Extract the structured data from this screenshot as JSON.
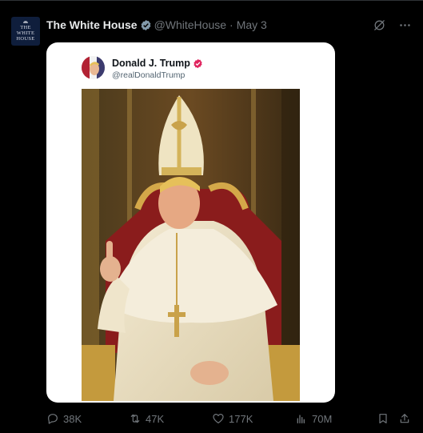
{
  "author": {
    "name": "The White House",
    "handle": "@WhiteHouse",
    "date": "May 3",
    "avatar_text": [
      "THE",
      "WHITE",
      "HOUSE"
    ]
  },
  "quoted": {
    "name": "Donald J. Trump",
    "handle": "@realDonaldTrump"
  },
  "actions": {
    "replies": "38K",
    "reposts": "47K",
    "likes": "177K",
    "views": "70M"
  },
  "icons": {
    "verified_author": "gray-verified-badge-icon",
    "verified_quoted": "pink-verified-badge-icon",
    "grok": "grok-icon",
    "more": "more-icon",
    "reply": "reply-icon",
    "repost": "repost-icon",
    "like": "heart-icon",
    "views": "views-icon",
    "bookmark": "bookmark-icon",
    "share": "share-icon"
  },
  "colors": {
    "background": "#000000",
    "text": "#e7e9ea",
    "muted": "#71767b",
    "card": "#ffffff",
    "pink_badge": "#e0245e"
  }
}
